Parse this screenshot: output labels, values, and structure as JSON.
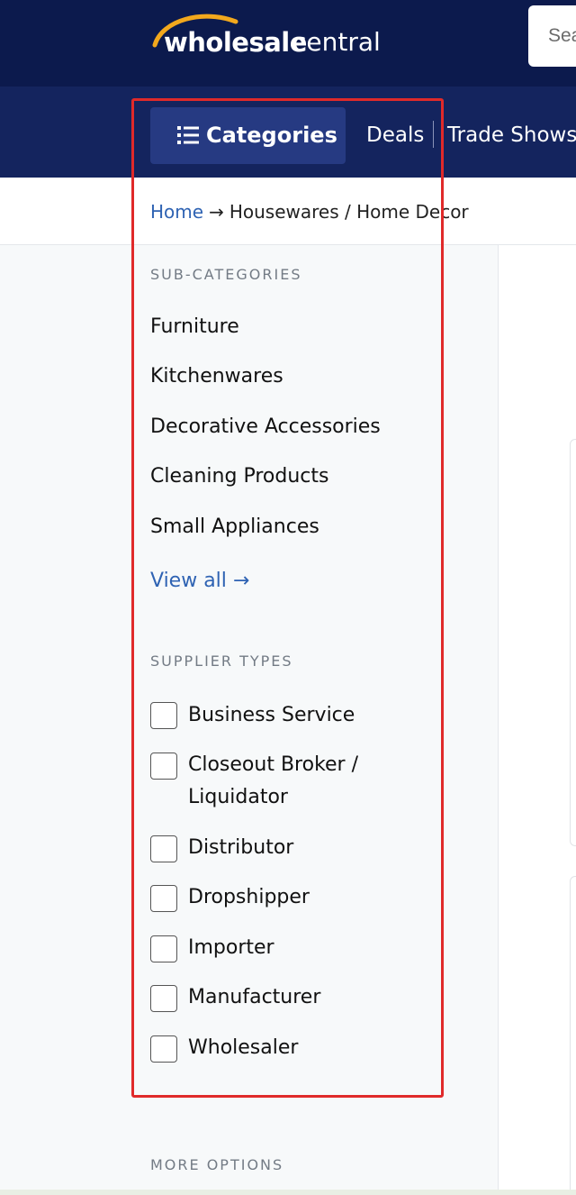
{
  "header": {
    "logo_bold": "wholesale",
    "logo_light": "central",
    "search_placeholder": "Search"
  },
  "nav": {
    "categories_label": "Categories",
    "links": [
      "Deals",
      "Trade Shows"
    ]
  },
  "breadcrumb": {
    "home": "Home",
    "arrow": "→",
    "current": "Housewares / Home Decor"
  },
  "sidebar": {
    "subcategories_heading": "SUB-CATEGORIES",
    "subcategories": [
      "Furniture",
      "Kitchenwares",
      "Decorative Accessories",
      "Cleaning Products",
      "Small Appliances"
    ],
    "view_all": "View all →",
    "supplier_types_heading": "SUPPLIER TYPES",
    "supplier_types": [
      {
        "label": "Business Service",
        "checked": false
      },
      {
        "label": "Closeout Broker /",
        "label2": "Liquidator",
        "checked": false
      },
      {
        "label": "Distributor",
        "checked": false
      },
      {
        "label": "Dropshipper",
        "checked": false
      },
      {
        "label": "Importer",
        "checked": false
      },
      {
        "label": "Manufacturer",
        "checked": false
      },
      {
        "label": "Wholesaler",
        "checked": false
      }
    ],
    "more_options_heading": "MORE OPTIONS"
  },
  "colors": {
    "header_bg": "#0c1a4d",
    "nav_bg": "#14245e",
    "active_nav_bg": "#263a82",
    "link": "#2f63b3",
    "logo_accent": "#f2a81d",
    "highlight": "#e02a2a"
  }
}
